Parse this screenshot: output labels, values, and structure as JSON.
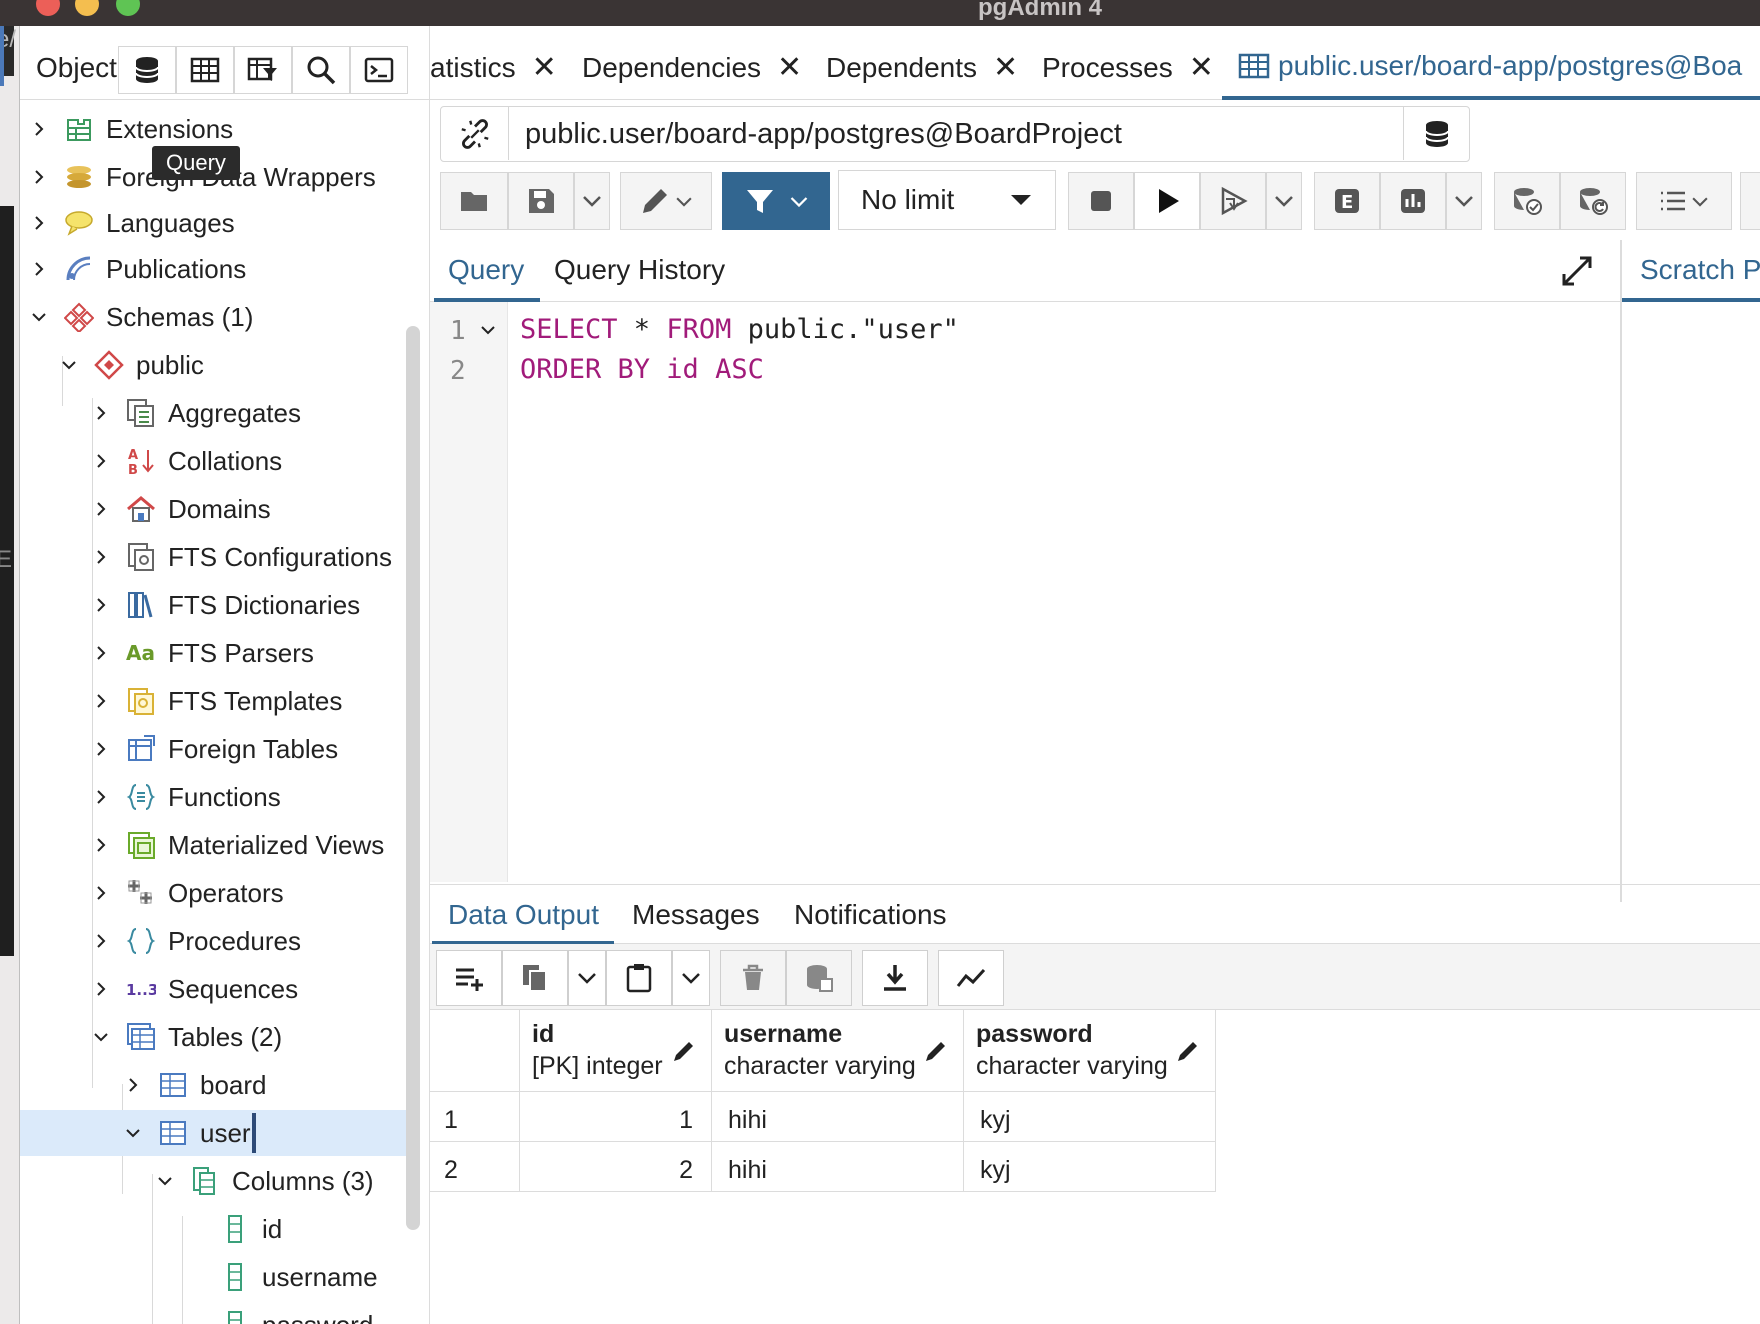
{
  "window": {
    "title": "pgAdmin 4"
  },
  "left_strip": {
    "text1": "e/",
    "text2": "E"
  },
  "explorer": {
    "label": "Object",
    "tooltip": "Query",
    "tree": [
      {
        "label": "Extensions",
        "expanded": false
      },
      {
        "label": "Foreign Data Wrappers",
        "expanded": false
      },
      {
        "label": "Languages",
        "expanded": false
      },
      {
        "label": "Publications",
        "expanded": false
      },
      {
        "label": "Schemas (1)",
        "expanded": true
      },
      {
        "label": "public",
        "expanded": true
      },
      {
        "label": "Aggregates",
        "expanded": false
      },
      {
        "label": "Collations",
        "expanded": false
      },
      {
        "label": "Domains",
        "expanded": false
      },
      {
        "label": "FTS Configurations",
        "expanded": false
      },
      {
        "label": "FTS Dictionaries",
        "expanded": false
      },
      {
        "label": "FTS Parsers",
        "expanded": false
      },
      {
        "label": "FTS Templates",
        "expanded": false
      },
      {
        "label": "Foreign Tables",
        "expanded": false
      },
      {
        "label": "Functions",
        "expanded": false
      },
      {
        "label": "Materialized Views",
        "expanded": false
      },
      {
        "label": "Operators",
        "expanded": false
      },
      {
        "label": "Procedures",
        "expanded": false
      },
      {
        "label": "Sequences",
        "expanded": false
      },
      {
        "label": "Tables (2)",
        "expanded": true
      },
      {
        "label": "board",
        "expanded": false
      },
      {
        "label": "user",
        "expanded": true,
        "selected": true
      },
      {
        "label": "Columns (3)",
        "expanded": true
      },
      {
        "label": "id"
      },
      {
        "label": "username"
      },
      {
        "label": "password"
      }
    ]
  },
  "tabs": [
    {
      "label": "atistics"
    },
    {
      "label": "Dependencies"
    },
    {
      "label": "Dependents"
    },
    {
      "label": "Processes"
    },
    {
      "label": "public.user/board-app/postgres@Boa",
      "active": true
    }
  ],
  "connection": {
    "string": "public.user/board-app/postgres@BoardProject"
  },
  "toolbar": {
    "limit": "No limit"
  },
  "query_tabs": {
    "query": "Query",
    "history": "Query History",
    "scratch": "Scratch P"
  },
  "editor": {
    "lines": [
      {
        "num": "1",
        "kw1": "SELECT",
        "mid": " * ",
        "kw2": "FROM",
        "rest": " public.\"user\""
      },
      {
        "num": "2",
        "kw1": "ORDER BY id ASC"
      }
    ]
  },
  "output_tabs": {
    "data": "Data Output",
    "messages": "Messages",
    "notifications": "Notifications"
  },
  "grid": {
    "columns": [
      {
        "name": "id",
        "type": "[PK] integer"
      },
      {
        "name": "username",
        "type": "character varying"
      },
      {
        "name": "password",
        "type": "character varying"
      }
    ],
    "rows": [
      {
        "row": "1",
        "id": "1",
        "username": "hihi",
        "password": "kyj"
      },
      {
        "row": "2",
        "id": "2",
        "username": "hihi",
        "password": "kyj"
      }
    ]
  },
  "colors": {
    "accent": "#326690",
    "keyword": "#a11b7a",
    "selection": "#dbeafa"
  }
}
